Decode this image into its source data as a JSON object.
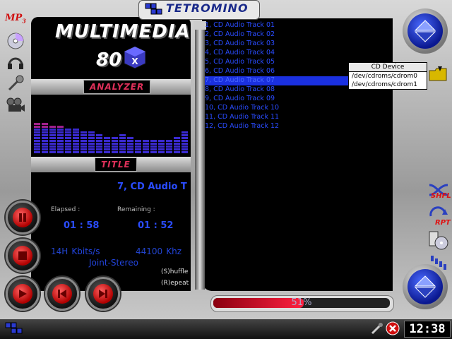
{
  "app": {
    "logo_text": "TETROMINO"
  },
  "title": {
    "line1": "MULTIMEDIA",
    "line2": "80",
    "cube_letter": "X"
  },
  "sections": {
    "analyzer": "ANALYZER",
    "title": "TITLE"
  },
  "now_playing": {
    "title": "7, CD Audio T",
    "elapsed_label": "Elapsed :",
    "remaining_label": "Remaining :",
    "elapsed": "01 : 58",
    "remaining": "01 : 52",
    "bitrate_value": "14H",
    "bitrate_unit": "Kbits/s",
    "samplerate_value": "44100",
    "samplerate_unit": "Khz",
    "mode": "Joint-Stereo",
    "shuffle": "(S)huffle",
    "repeat": "(R)epeat"
  },
  "analyzer_levels": [
    0.6,
    0.65,
    0.55,
    0.55,
    0.5,
    0.5,
    0.45,
    0.45,
    0.4,
    0.35,
    0.35,
    0.4,
    0.35,
    0.3,
    0.3,
    0.3,
    0.3,
    0.3,
    0.35,
    0.45
  ],
  "playlist": [
    "1, CD Audio Track 01",
    "2, CD Audio Track 02",
    "3, CD Audio Track 03",
    "4, CD Audio Track 04",
    "5, CD Audio Track 05",
    "6, CD Audio Track 06",
    "7, CD Audio Track 07",
    "8, CD Audio Track 08",
    "9, CD Audio Track 09",
    "10, CD Audio Track 10",
    "11, CD Audio Track 11",
    "12, CD Audio Track 12"
  ],
  "playlist_selected_index": 6,
  "cd_menu": {
    "header": "CD Device",
    "options": [
      "/dev/cdroms/cdrom0",
      "/dev/cdroms/cdrom1"
    ]
  },
  "progress": {
    "percent": 51,
    "label": "51%"
  },
  "side_buttons": {
    "shuffle": "SHFL",
    "repeat": "RPT"
  },
  "sidebar_icons": [
    "mp3-icon",
    "cd-icon",
    "headphones-icon",
    "microphone-icon",
    "film-icon"
  ],
  "clock": "12:38",
  "colors": {
    "accent": "#2a4cff",
    "selection": "#1a30e0",
    "progress": "#ff2040",
    "tag": "#e0305a"
  }
}
